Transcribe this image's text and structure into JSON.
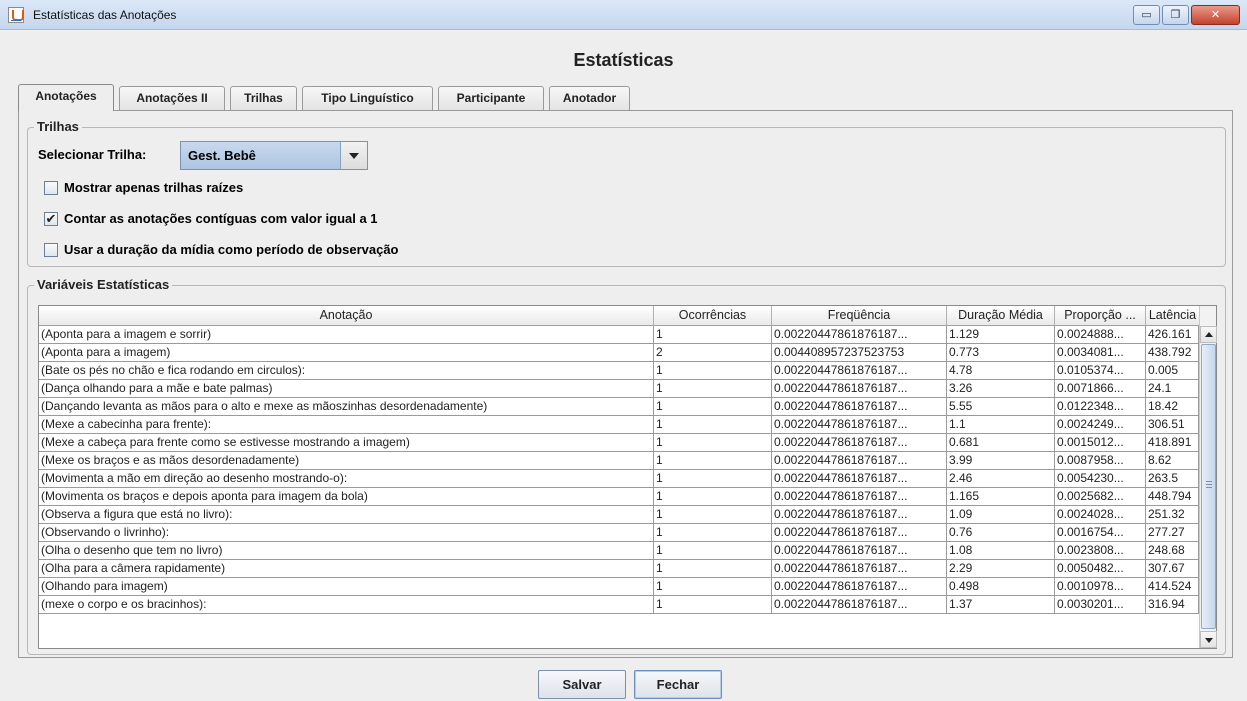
{
  "window": {
    "title": "Estatísticas das Anotações",
    "controls": {
      "minimize": "▭",
      "maximize": "❐",
      "close": "✕"
    }
  },
  "heading": "Estatísticas",
  "tabs": [
    {
      "label": "Anotações",
      "active": true
    },
    {
      "label": "Anotações II",
      "active": false
    },
    {
      "label": "Trilhas",
      "active": false
    },
    {
      "label": "Tipo Linguístico",
      "active": false
    },
    {
      "label": "Participante",
      "active": false
    },
    {
      "label": "Anotador",
      "active": false
    }
  ],
  "trilhas_group": {
    "title": "Trilhas",
    "select_label": "Selecionar Trilha:",
    "selected_value": "Gest. Bebê",
    "options": [
      {
        "label": "Mostrar apenas trilhas raízes",
        "checked": false
      },
      {
        "label": "Contar as anotações contíguas com valor igual a 1",
        "checked": true
      },
      {
        "label": "Usar a duração da mídia como período de observação",
        "checked": false
      }
    ],
    "check_mark": "✔"
  },
  "stats_group": {
    "title": "Variáveis Estatísticas",
    "columns": [
      "Anotação",
      "Ocorrências",
      "Freqüência",
      "Duração Média",
      "Proporção ...",
      "Latência"
    ],
    "rows": [
      [
        "(Aponta para a imagem e sorrir)",
        "1",
        "0.00220447861876187...",
        "1.129",
        "0.0024888...",
        "426.161"
      ],
      [
        "(Aponta para a imagem)",
        "2",
        "0.004408957237523753",
        "0.773",
        "0.0034081...",
        "438.792"
      ],
      [
        "(Bate os pés no chão e fica rodando em circulos):",
        "1",
        "0.00220447861876187...",
        "4.78",
        "0.0105374...",
        "0.005"
      ],
      [
        "(Dança olhando para a mãe e bate palmas)",
        "1",
        "0.00220447861876187...",
        "3.26",
        "0.0071866...",
        "24.1"
      ],
      [
        "(Dançando levanta as mãos para o alto e mexe as mãoszinhas desordenadamente)",
        "1",
        "0.00220447861876187...",
        "5.55",
        "0.0122348...",
        "18.42"
      ],
      [
        "(Mexe a cabecinha para frente):",
        "1",
        "0.00220447861876187...",
        "1.1",
        "0.0024249...",
        "306.51"
      ],
      [
        "(Mexe a cabeça para frente como se estivesse mostrando a imagem)",
        "1",
        "0.00220447861876187...",
        "0.681",
        "0.0015012...",
        "418.891"
      ],
      [
        "(Mexe os braços e as mãos desordenadamente)",
        "1",
        "0.00220447861876187...",
        "3.99",
        "0.0087958...",
        "8.62"
      ],
      [
        "(Movimenta a mão em direção ao desenho mostrando-o):",
        "1",
        "0.00220447861876187...",
        "2.46",
        "0.0054230...",
        "263.5"
      ],
      [
        "(Movimenta os braços e depois aponta para imagem da bola)",
        "1",
        "0.00220447861876187...",
        "1.165",
        "0.0025682...",
        "448.794"
      ],
      [
        "(Observa a figura que está no livro):",
        "1",
        "0.00220447861876187...",
        "1.09",
        "0.0024028...",
        "251.32"
      ],
      [
        "(Observando o livrinho):",
        "1",
        "0.00220447861876187...",
        "0.76",
        "0.0016754...",
        "277.27"
      ],
      [
        "(Olha o desenho que tem no livro)",
        "1",
        "0.00220447861876187...",
        "1.08",
        "0.0023808...",
        "248.68"
      ],
      [
        "(Olha para a câmera rapidamente)",
        "1",
        "0.00220447861876187...",
        "2.29",
        "0.0050482...",
        "307.67"
      ],
      [
        "(Olhando para imagem)",
        "1",
        "0.00220447861876187...",
        "0.498",
        "0.0010978...",
        "414.524"
      ],
      [
        "(mexe o corpo e os bracinhos):",
        "1",
        "0.00220447861876187...",
        "1.37",
        "0.0030201...",
        "316.94"
      ]
    ]
  },
  "buttons": {
    "save": "Salvar",
    "close": "Fechar"
  }
}
